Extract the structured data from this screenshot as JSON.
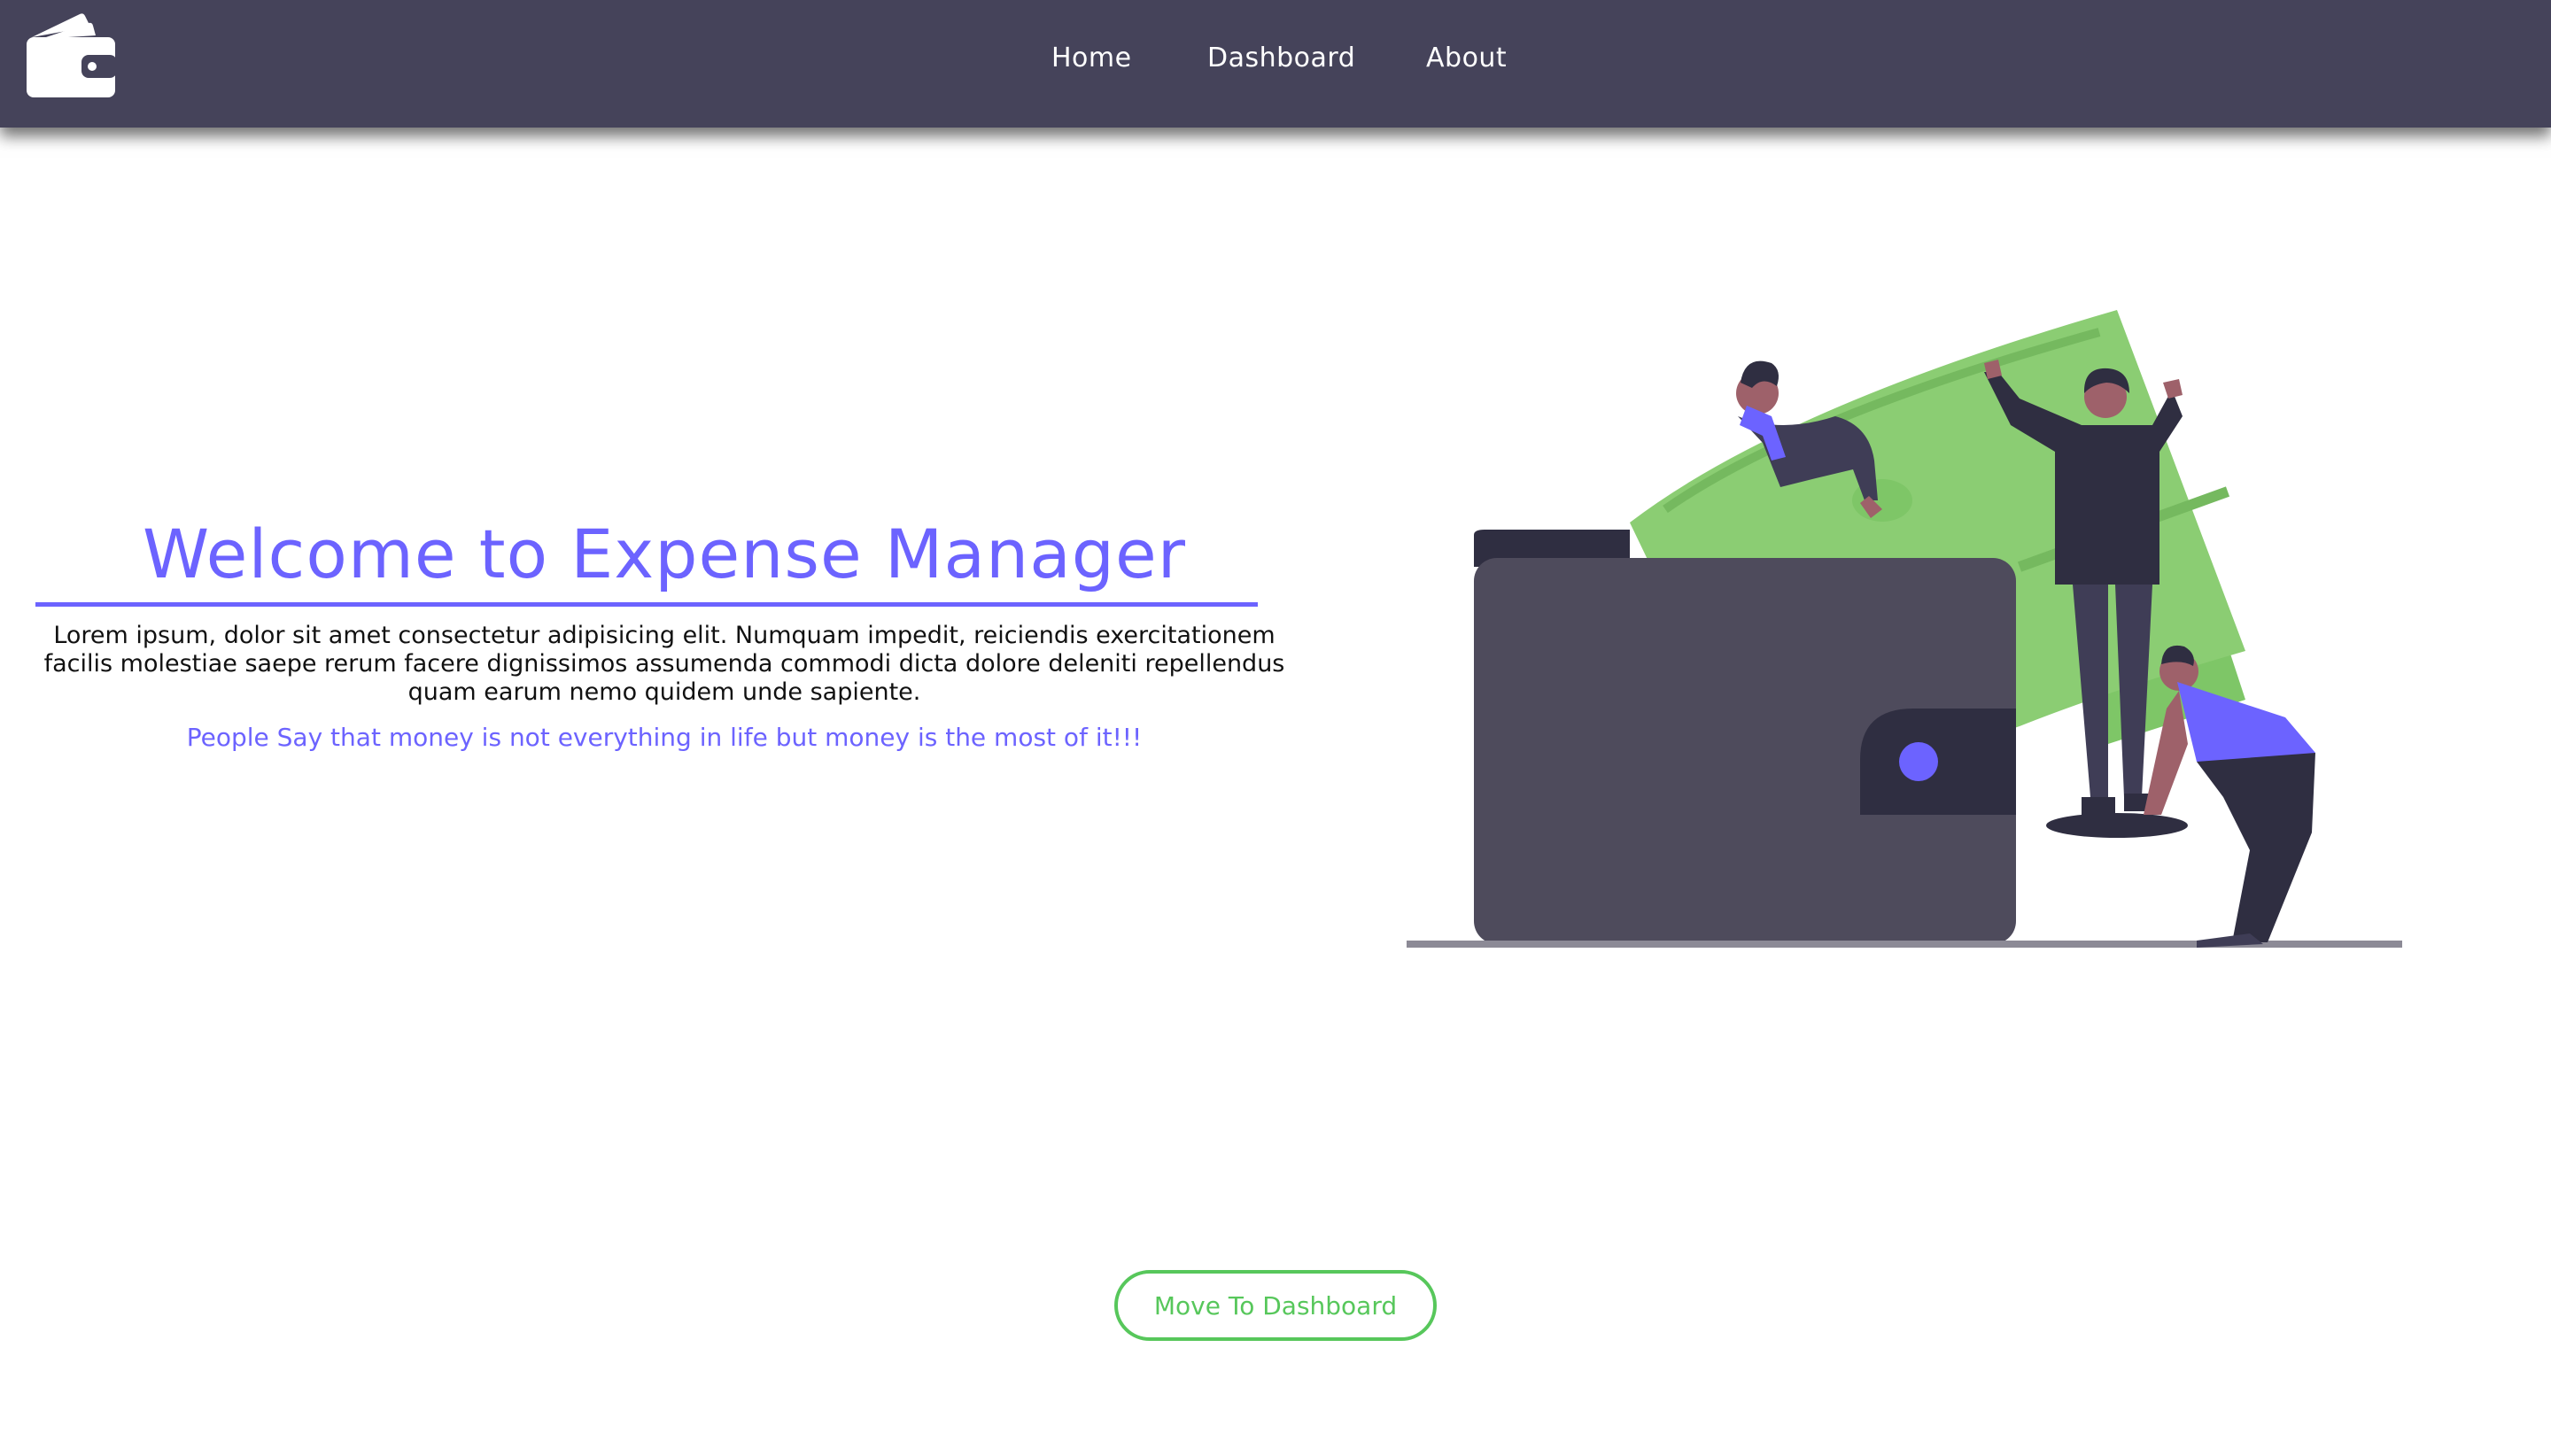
{
  "navbar": {
    "logo_icon": "wallet-icon",
    "links": [
      {
        "label": "Home"
      },
      {
        "label": "Dashboard"
      },
      {
        "label": "About"
      }
    ],
    "background": "#45435a"
  },
  "hero": {
    "title": "Welcome to Expense Manager",
    "description": "Lorem ipsum, dolor sit amet consectetur adipisicing elit. Numquam impedit, reiciendis exercitationem facilis molestiae saepe rerum facere dignissimos assumenda commodi dicta dolore deleniti repellendus quam earum nemo quidem unde sapiente.",
    "tagline": "People Say that money is not everything in life but money is the most of it!!!",
    "illustration": "wallet-money-people-illustration"
  },
  "cta": {
    "label": "Move To Dashboard"
  },
  "colors": {
    "accent": "#6c63ff",
    "cta_green": "#57c75b",
    "money_green": "#8bcd73",
    "wallet_dark": "#4e4b5c"
  }
}
